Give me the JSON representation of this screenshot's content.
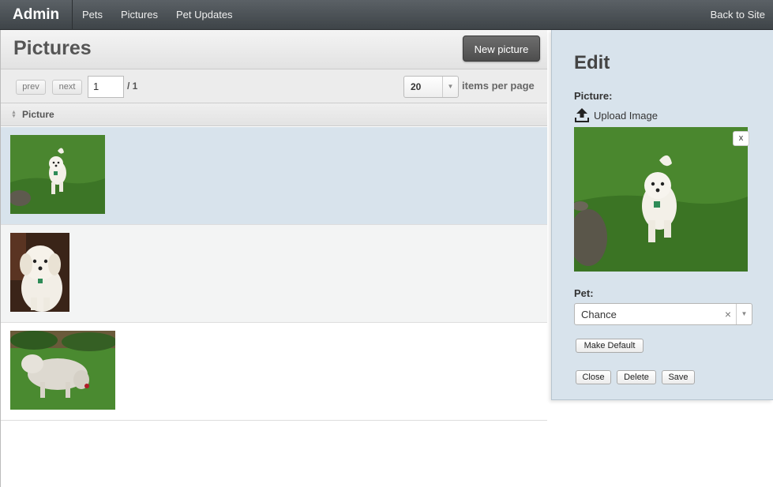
{
  "topbar": {
    "brand": "Admin",
    "nav": [
      "Pets",
      "Pictures",
      "Pet Updates"
    ],
    "back_link": "Back to Site"
  },
  "list": {
    "title": "Pictures",
    "new_button": "New picture",
    "pager": {
      "prev": "prev",
      "next": "next",
      "page": "1",
      "total": "/ 1",
      "per_page": "20",
      "per_page_label": "items per page"
    },
    "column_header": "Picture",
    "rows": [
      {
        "picture": "dog-running-on-grass",
        "selected": true
      },
      {
        "picture": "dog-sitting-closeup",
        "selected": false
      },
      {
        "picture": "dog-sniffing-grass",
        "selected": false
      }
    ]
  },
  "edit": {
    "title": "Edit",
    "picture_label": "Picture:",
    "upload_label": "Upload Image",
    "remove_label": "x",
    "pet_label": "Pet:",
    "pet_value": "Chance",
    "make_default": "Make Default",
    "close": "Close",
    "delete": "Delete",
    "save": "Save"
  },
  "colors": {
    "topbar": "#4b5156",
    "selected_row": "#d8e3ec",
    "edit_panel": "#d8e3ec",
    "primary_button": "#5d5d5d"
  }
}
